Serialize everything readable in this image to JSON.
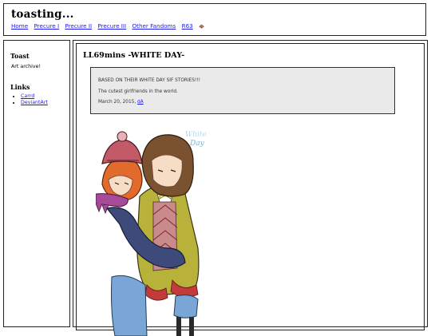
{
  "site": {
    "title": "toasting...",
    "nav": [
      "Home",
      "Precure I",
      "Precure II",
      "Precure III",
      "Other Fandoms",
      "R63"
    ],
    "nav_icon": "shell-icon"
  },
  "sidebar": {
    "heading": "Toast",
    "description": "Art archive!",
    "links_heading": "Links",
    "links": [
      "Carrd",
      "DeviantArt"
    ]
  },
  "post": {
    "title": "LL69mins -WHITE DAY-",
    "note_line1": "BASED ON THEIR WHITE DAY SIF STORIES!!!",
    "note_line2": "The cutest girlfriends in the world.",
    "date": "March 20, 2015,",
    "date_link": "dA",
    "art_caption": "White Day"
  },
  "colors": {
    "link": "#1a1aee",
    "note_bg": "#eaeaea"
  }
}
